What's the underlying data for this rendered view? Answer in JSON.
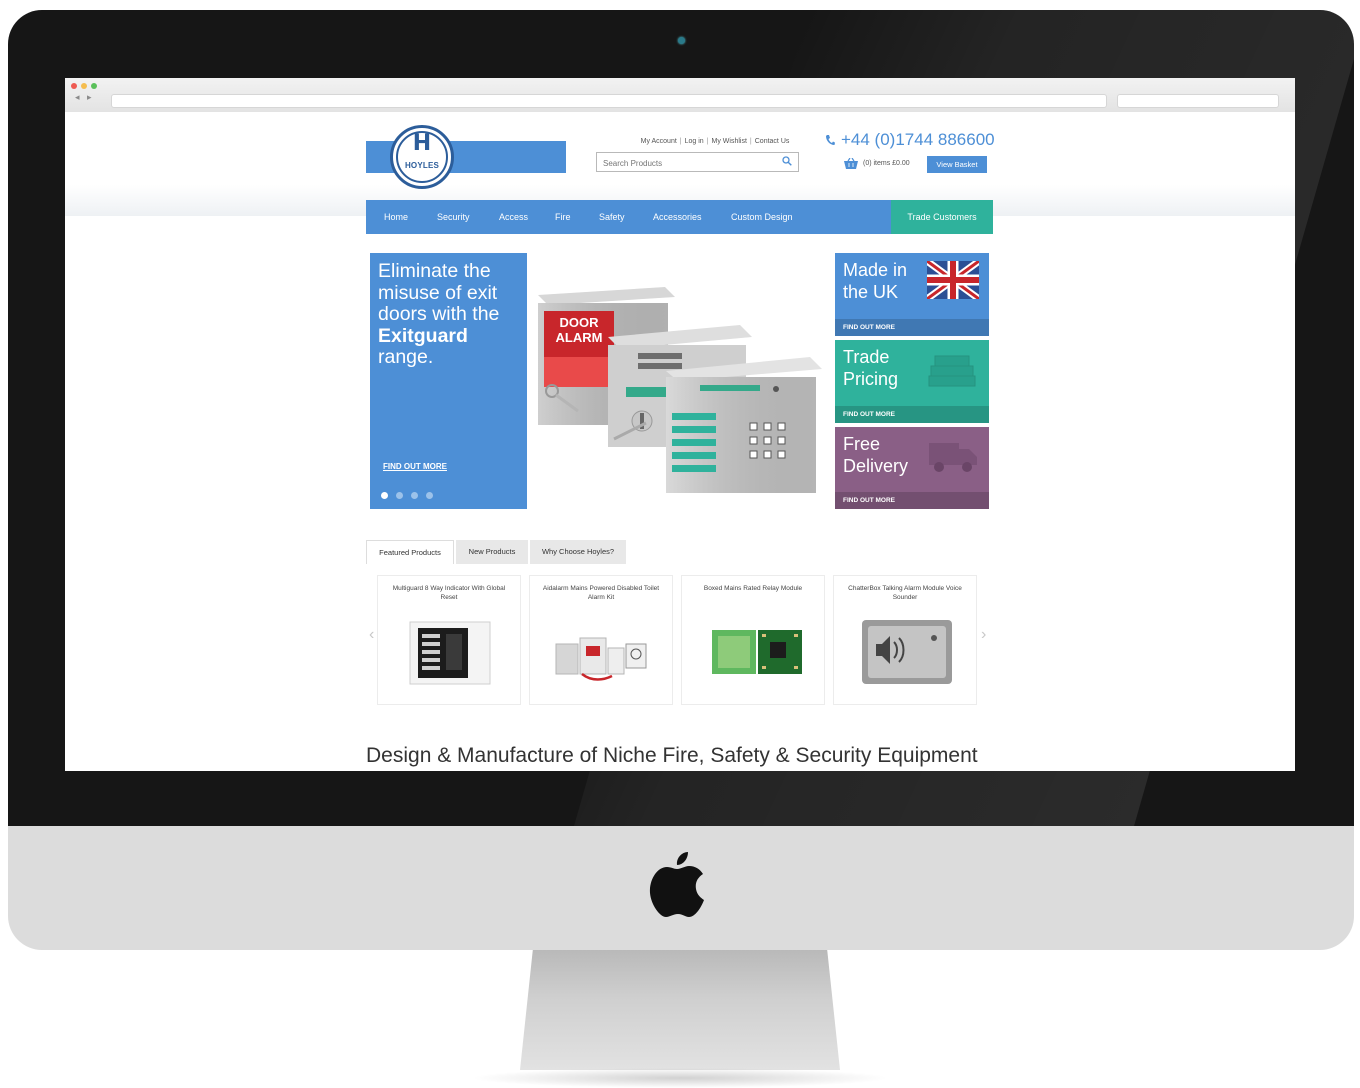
{
  "site": {
    "logo_text": "HOYLES",
    "top_links": [
      "My Account",
      "Log in",
      "My Wishlist",
      "Contact Us"
    ],
    "search_placeholder": "Search Products",
    "phone": "+44 (0)1744 886600",
    "basket_text": "(0) items £0.00",
    "view_basket_label": "View Basket"
  },
  "nav": {
    "items": [
      "Home",
      "Security",
      "Access",
      "Fire",
      "Safety",
      "Accessories",
      "Custom Design"
    ],
    "trade_label": "Trade Customers"
  },
  "hero": {
    "line1": "Eliminate the misuse of exit doors with the",
    "highlight": "Exitguard",
    "line2": "range.",
    "link": "FIND OUT MORE",
    "door_alarm": "DOOR ALARM",
    "slide_count": 4
  },
  "promos": [
    {
      "title": "Made in the UK",
      "link": "FIND OUT MORE",
      "color": "#4d8fd6",
      "icon": "union-jack-flag-icon"
    },
    {
      "title": "Trade Pricing",
      "link": "FIND OUT MORE",
      "color": "#2fb29c",
      "icon": "money-stack-icon"
    },
    {
      "title": "Free Delivery",
      "link": "FIND OUT MORE",
      "color": "#8a5f86",
      "icon": "delivery-van-icon"
    }
  ],
  "tabs": [
    "Featured Products",
    "New Products",
    "Why Choose Hoyles?"
  ],
  "products": [
    {
      "name": "Multiguard 8 Way Indicator With Global Reset"
    },
    {
      "name": "Aidalarm Mains Powered Disabled Toilet Alarm Kit"
    },
    {
      "name": "Boxed Mains Rated Relay Module"
    },
    {
      "name": "ChatterBox Talking Alarm Module Voice Sounder"
    }
  ],
  "tagline": "Design & Manufacture of Niche Fire, Safety & Security Equipment",
  "colors": {
    "brand_blue": "#4d8fd6",
    "trade_green": "#2fb29c",
    "delivery_purple": "#8a5f86",
    "bezel": "#161616",
    "chin": "#dcdcdc"
  }
}
